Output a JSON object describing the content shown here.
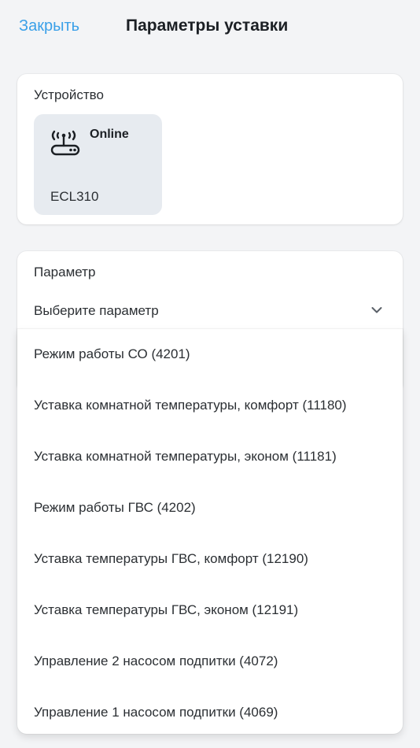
{
  "header": {
    "close_label": "Закрыть",
    "title": "Параметры уставки"
  },
  "device_section": {
    "label": "Устройство",
    "device": {
      "icon": "router-icon",
      "status": "Online",
      "name": "ECL310"
    }
  },
  "parameter_section": {
    "label": "Параметр",
    "select_placeholder": "Выберите параметр",
    "options": [
      "Режим работы СО (4201)",
      "Уставка комнатной температуры, комфорт (11180)",
      "Уставка комнатной температуры, эконом (11181)",
      "Режим работы ГВС (4202)",
      "Уставка температуры ГВС, комфорт (12190)",
      "Уставка температуры ГВС, эконом (12191)",
      "Управление 2 насосом подпитки (4072)",
      "Управление 1 насосом подпитки (4069)"
    ]
  },
  "colors": {
    "accent": "#3aa0e8",
    "background": "#f3f4f6",
    "tile": "#e7ebf0"
  }
}
